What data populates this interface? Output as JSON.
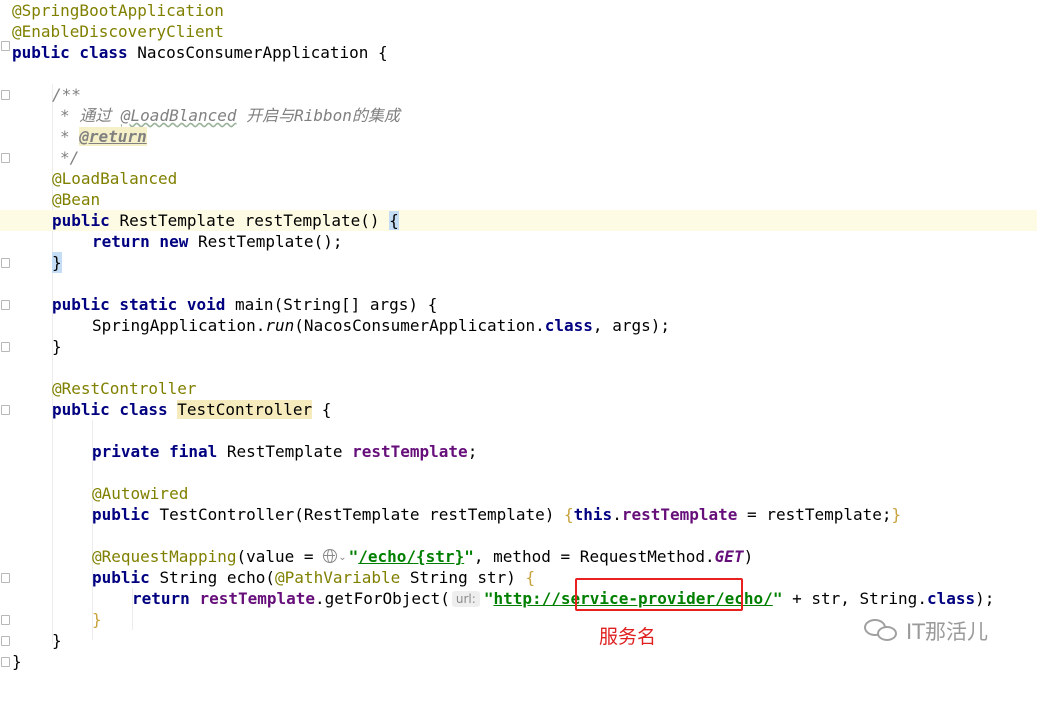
{
  "editor": {
    "lines": {
      "l1": "@SpringBootApplication",
      "l2": "@EnableDiscoveryClient",
      "l3_kw": "public class ",
      "l3_name": "NacosConsumerApplication {",
      "l5": "/**",
      "l6_star": "* 通过 ",
      "l6_ref": "@LoadBlanced",
      "l6_rest": " 开启与Ribbon的集成",
      "l7_star": "* ",
      "l7_tag": "@return",
      "l8": "*/",
      "l9": "@LoadBalanced",
      "l10": "@Bean",
      "l11_kw": "public ",
      "l11_rest": "RestTemplate restTemplate() ",
      "l11_brace": "{",
      "l12_kw": "return new ",
      "l12_rest": "RestTemplate();",
      "l13": "}",
      "l15_kw": "public static void ",
      "l15_rest": "main(String[] args) {",
      "l16_a": "SpringApplication.",
      "l16_run": "run",
      "l16_b": "(NacosConsumerApplication.",
      "l16_class": "class",
      "l16_c": ", args);",
      "l17": "}",
      "l19": "@RestController",
      "l20_kw": "public class ",
      "l20_name": "TestController",
      "l20_rest": " {",
      "l22_kw": "private final ",
      "l22_type": "RestTemplate ",
      "l22_field": "restTemplate",
      "l22_semi": ";",
      "l24": "@Autowired",
      "l25_kw": "public ",
      "l25_rest": "TestController(RestTemplate restTemplate) ",
      "l25_brace": "{",
      "l25_this": "this",
      "l25_dot": ".",
      "l25_field": "restTemplate",
      "l25_end": " = restTemplate;",
      "l25_close": "}",
      "l27_anno": "@RequestMapping",
      "l27_a": "(value = ",
      "l27_chev": "⌄",
      "l27_str_q": "\"",
      "l27_str_path": "/echo/{str}",
      "l27_str_q2": "\"",
      "l27_b": ", method = RequestMethod.",
      "l27_get": "GET",
      "l27_c": ")",
      "l28_kw": "public ",
      "l28_a": "String echo(",
      "l28_anno": "@PathVariable",
      "l28_b": " String str) ",
      "l28_brace": "{",
      "l29_kw": "return ",
      "l29_field": "restTemplate",
      "l29_a": ".getForObject(",
      "l29_hint": "url:",
      "l29_str_q": "\"",
      "l29_str_proto": "http://",
      "l29_str_host": "service-provider",
      "l29_str_path": "/echo/",
      "l29_str_q2": "\"",
      "l29_b": " + str, String.",
      "l29_class": "class",
      "l29_c": ");",
      "l30": "}",
      "l31": "}",
      "l32": "}"
    }
  },
  "annotation": {
    "label": "服务名",
    "color": "#e02020"
  },
  "watermark": {
    "text": "IT那活儿"
  }
}
